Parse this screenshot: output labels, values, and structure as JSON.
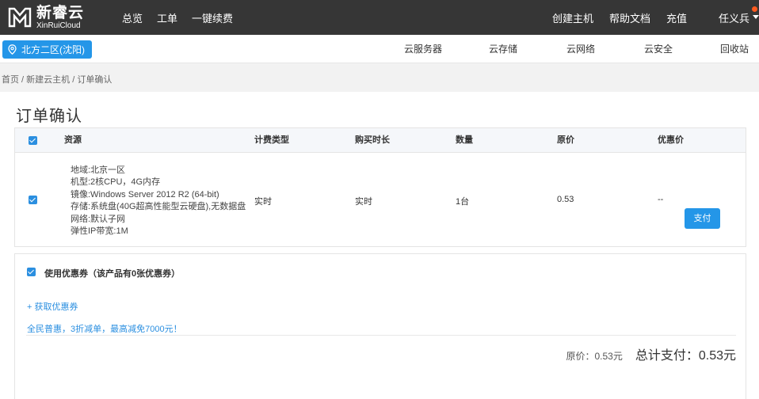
{
  "header": {
    "logo_cn": "新睿云",
    "logo_en": "XinRuiCloud",
    "nav_left": [
      "总览",
      "工单",
      "一键续费"
    ],
    "nav_right": [
      "创建主机",
      "帮助文档",
      "充值"
    ],
    "user_name": "任义兵"
  },
  "subnav": {
    "region": "北方二区(沈阳)",
    "items": [
      "云服务器",
      "云存储",
      "云网络",
      "云安全",
      "回收站"
    ]
  },
  "breadcrumb": "首页 / 新建云主机 / 订单确认",
  "page_title": "订单确认",
  "table": {
    "headers": [
      "资源",
      "计费类型",
      "购买时长",
      "数量",
      "原价",
      "优惠价"
    ],
    "row": {
      "resource": [
        "地域:北京一区",
        "机型:2核CPU，4G内存",
        "镜像:Windows Server 2012 R2 (64-bit)",
        "存储:系统盘(40G超高性能型云硬盘),无数据盘",
        "网络:默认子网",
        "弹性IP带宽:1M"
      ],
      "billing": "实时",
      "duration": "实时",
      "quantity": "1台",
      "original_price": "0.53",
      "discount_price": "--"
    }
  },
  "coupon": {
    "label": "使用优惠券（该产品有0张优惠券）",
    "get_link": "+ 获取优惠券",
    "promo": "全民普惠，3折减单，最高减免7000元！"
  },
  "totals": {
    "original": "原价：0.53元",
    "total": "总计支付：0.53元"
  },
  "pay_button": "支付"
}
